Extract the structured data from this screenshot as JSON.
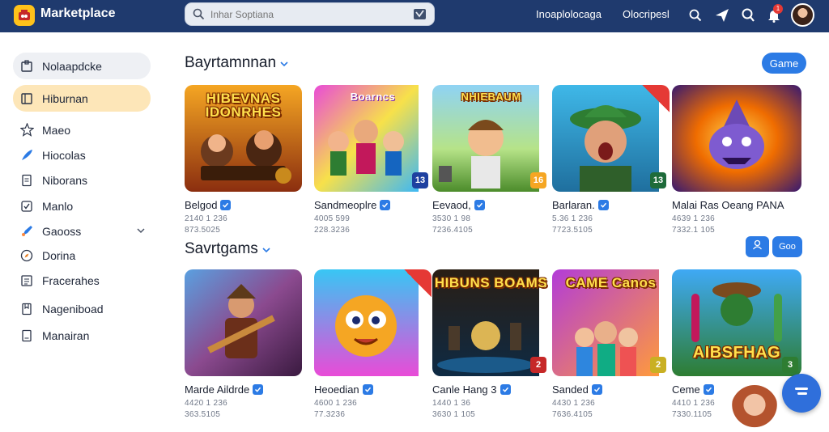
{
  "app": {
    "title": "Marketplace"
  },
  "search": {
    "placeholder": "Inhar Soptiana",
    "value": ""
  },
  "nav": {
    "link1": "Inoaplolocaga",
    "link2": "Olocripesl",
    "notification_count": "1"
  },
  "colors": {
    "topbar": "#1f3a6e",
    "accent": "#2c7be5",
    "active_item": "#fde6b8",
    "brand": "#ffc21a"
  },
  "sidebar": {
    "items": [
      {
        "label": "Nolaapdcke",
        "icon": "store-icon"
      },
      {
        "label": "Hiburnan",
        "icon": "calendar-icon"
      },
      {
        "label": "Maeo",
        "icon": "star-icon"
      },
      {
        "label": "Hiocolas",
        "icon": "feather-icon"
      },
      {
        "label": "Niborans",
        "icon": "document-icon"
      },
      {
        "label": "Manlo",
        "icon": "check-square-icon"
      },
      {
        "label": "Gaooss",
        "icon": "rocket-icon"
      },
      {
        "label": "Dorina",
        "icon": "compass-icon"
      },
      {
        "label": "Fracerahes",
        "icon": "list-icon"
      },
      {
        "label": "Nageniboad",
        "icon": "bookmark-icon"
      },
      {
        "label": "Manairan",
        "icon": "file-icon"
      }
    ]
  },
  "section1": {
    "title": "Bayrtamnnan",
    "button": "Game",
    "cards": [
      {
        "caption": "HIBEVNAS IDONRHES",
        "title": "Belgod",
        "meta1": "2140 1 236",
        "meta2": "873.5025",
        "badge": ""
      },
      {
        "caption": "Boarncs",
        "title": "Sandmeoplre",
        "meta1": "4005 599",
        "meta2": "228.3236",
        "badge": "13"
      },
      {
        "caption": "NHIEBAUM",
        "title": "Eevaod,",
        "meta1": "3530 1 98",
        "meta2": "7236.4105",
        "badge": "16"
      },
      {
        "caption": "",
        "title": "Barlaran.",
        "meta1": "5.36 1 236",
        "meta2": "7723.5105",
        "badge": "13"
      },
      {
        "caption": "",
        "title": "Malai Ras Oeang PANA",
        "meta1": "4639 1 236",
        "meta2": "7332.1 105",
        "badge": ""
      }
    ]
  },
  "section2": {
    "title": "Savrtgams",
    "button": "Goo",
    "cards": [
      {
        "caption": "",
        "title": "Marde Aildrde",
        "meta1": "4420 1 236",
        "meta2": "363.5105",
        "badge": ""
      },
      {
        "caption": "",
        "title": "Heoedian",
        "meta1": "4600 1 236",
        "meta2": "77.3236",
        "badge": ""
      },
      {
        "caption": "HIBUNS BOAMS",
        "title": "Canle Hang 3",
        "meta1": "1440 1 36",
        "meta2": "3630 1 105",
        "badge": "2"
      },
      {
        "caption": "CAME Canos",
        "title": "Sanded",
        "meta1": "4430 1 236",
        "meta2": "7636.4105",
        "badge": "2"
      },
      {
        "caption": "AIBSFHAG",
        "title": "Ceme",
        "meta1": "4410 1 236",
        "meta2": "7330.1105",
        "badge": "3"
      }
    ]
  }
}
